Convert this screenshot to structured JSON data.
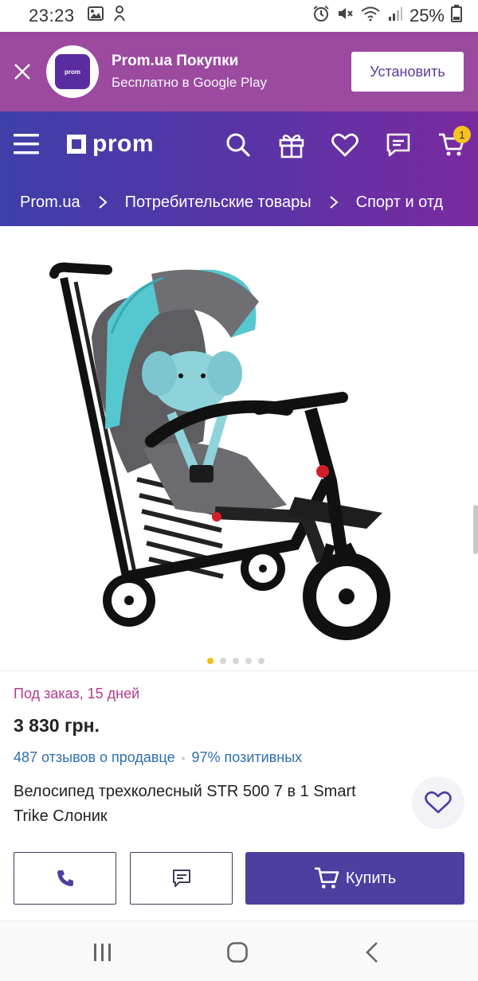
{
  "status_bar": {
    "time": "23:23",
    "battery": "25%",
    "icons": [
      "gallery-icon",
      "notification-icon",
      "alarm-icon",
      "mute-icon",
      "wifi-icon",
      "signal-icon",
      "battery-icon"
    ]
  },
  "install_banner": {
    "app_title": "Prom.ua Покупки",
    "app_subtitle": "Бесплатно в Google Play",
    "install_label": "Установить",
    "logo_text": "prom"
  },
  "header": {
    "logo_text": "prom",
    "cart_count": "1",
    "icons": [
      "menu-icon",
      "search-icon",
      "gift-icon",
      "heart-icon",
      "messages-icon",
      "cart-icon"
    ]
  },
  "breadcrumbs": [
    "Prom.ua",
    "Потребительские товары",
    "Спорт и отд"
  ],
  "gallery": {
    "image_count": 5,
    "active_index": 0
  },
  "product": {
    "availability": "Под заказ, 15 дней",
    "price": "3 830 грн.",
    "reviews": "487 отзывов о продавце",
    "positive": "97% позитивных",
    "title": "Велосипед трехколесный STR 500 7 в 1 Smart Trike Слоник"
  },
  "action_bar": {
    "buy_label": "Купить"
  },
  "colors": {
    "banner_bg": "#9b4aa0",
    "header_start": "#3e3fa8",
    "header_end": "#7b2aa0",
    "availability": "#b23a8a",
    "link": "#2f6fb0",
    "buy_button": "#4b3fa0",
    "badge": "#f6c21c"
  }
}
